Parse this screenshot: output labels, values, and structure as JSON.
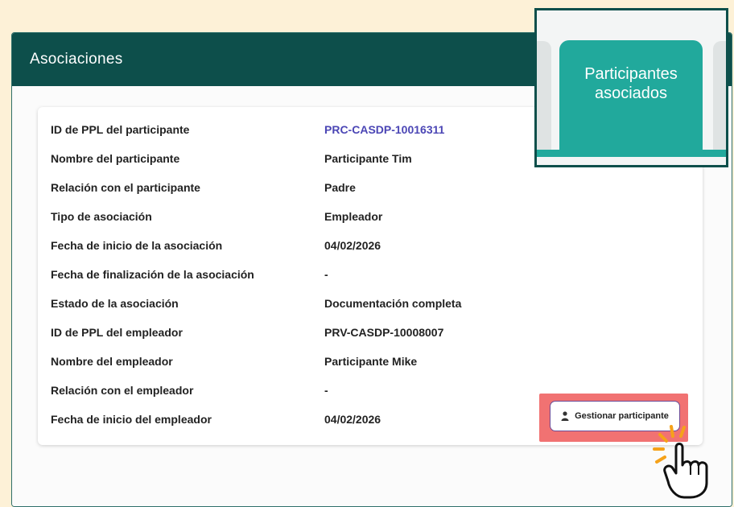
{
  "card": {
    "title": "Asociaciones"
  },
  "details": [
    {
      "label": "ID de PPL del participante",
      "value": "PRC-CASDP-10016311",
      "is_link": true
    },
    {
      "label": "Nombre del participante",
      "value": "Participante Tim"
    },
    {
      "label": "Relación con el participante",
      "value": "Padre"
    },
    {
      "label": "Tipo de asociación",
      "value": "Empleador"
    },
    {
      "label": "Fecha de inicio de la asociación",
      "value": "04/02/2026"
    },
    {
      "label": "Fecha de finalización de la asociación",
      "value": "-"
    },
    {
      "label": "Estado de la asociación",
      "value": "Documentación completa"
    },
    {
      "label": "ID de PPL del empleador",
      "value": "PRV-CASDP-10008007"
    },
    {
      "label": "Nombre del empleador",
      "value": "Participante Mike"
    },
    {
      "label": "Relación con el empleador",
      "value": "-"
    },
    {
      "label": "Fecha de inicio del empleador",
      "value": "04/02/2026"
    }
  ],
  "actions": {
    "manage_label": "Gestionar participante",
    "manage_icon": "user-icon"
  },
  "callout": {
    "tab_label_line1": "Participantes",
    "tab_label_line2": "asociados"
  },
  "colors": {
    "header": "#0d4f4b",
    "tab": "#21a99c",
    "link": "#4b46b5",
    "highlight": "#f06a6a",
    "button_border": "#6b4b97",
    "page_bg": "#fdf1d7"
  }
}
